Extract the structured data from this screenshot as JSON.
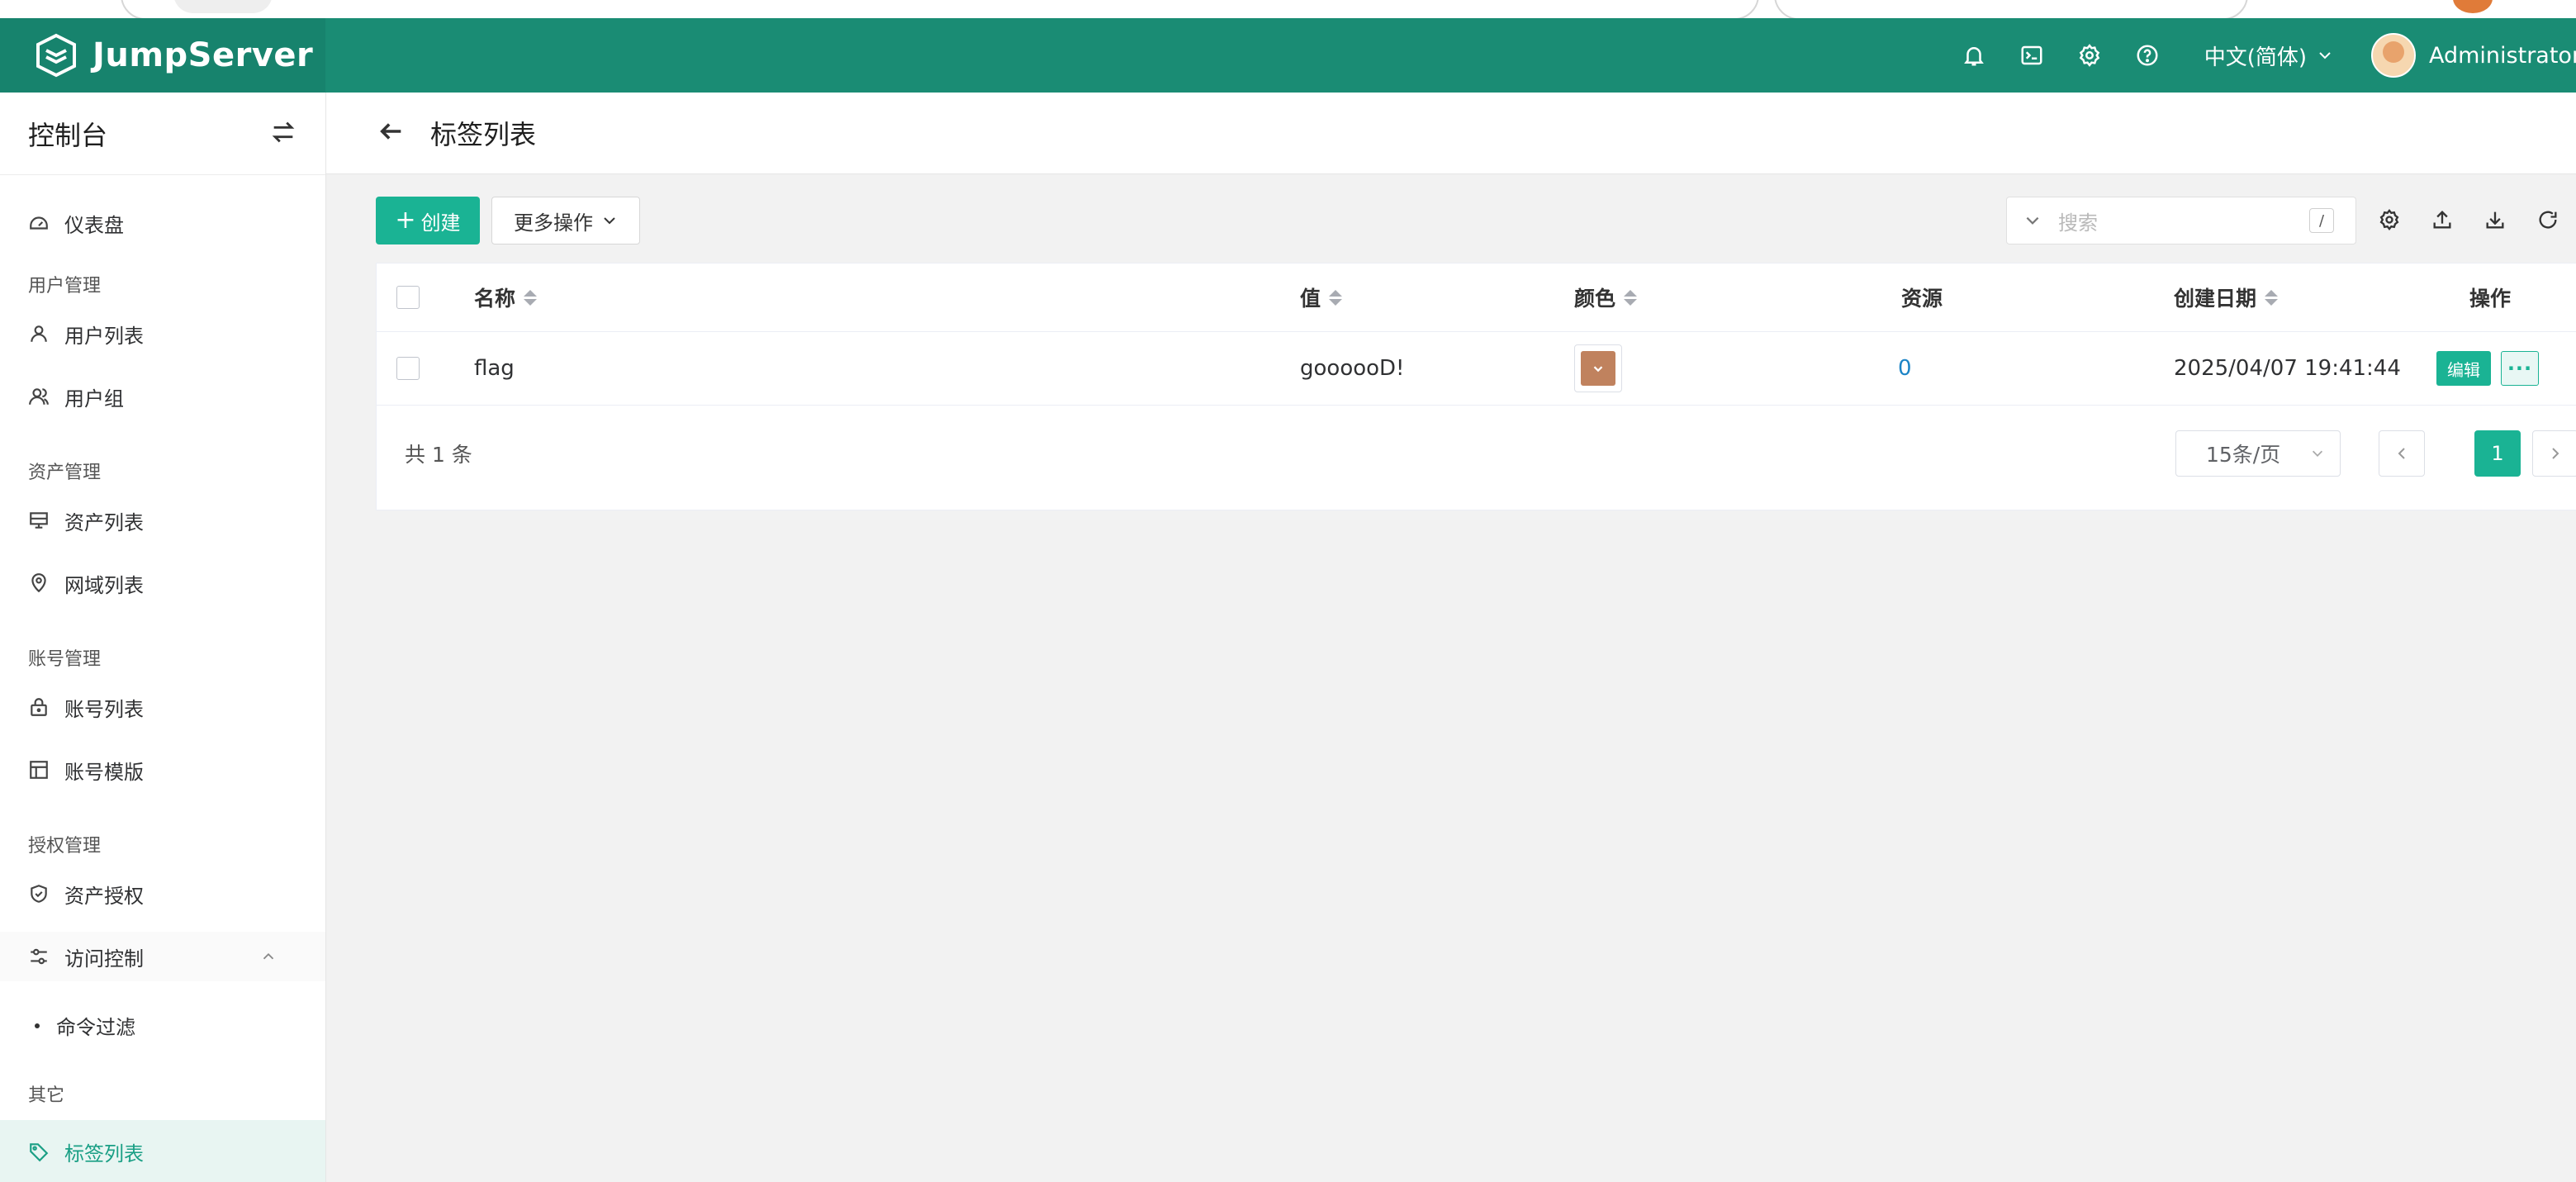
{
  "app": {
    "brand": "JumpServer",
    "language": "中文(简体)",
    "user": "Administrator"
  },
  "header_icons": [
    "bell-icon",
    "terminal-icon",
    "gear-icon",
    "help-icon"
  ],
  "sidebar": {
    "title": "控制台",
    "dashboard": "仪表盘",
    "groups": {
      "users": "用户管理",
      "assets": "资产管理",
      "accounts": "账号管理",
      "perms": "授权管理",
      "other": "其它"
    },
    "items": {
      "user_list": "用户列表",
      "user_group": "用户组",
      "asset_list": "资产列表",
      "zone_list": "网域列表",
      "account_list": "账号列表",
      "account_template": "账号模版",
      "asset_perm": "资产授权",
      "access_control": "访问控制",
      "cmd_filter": "命令过滤",
      "label_list": "标签列表"
    }
  },
  "page": {
    "title": "标签列表"
  },
  "toolbar": {
    "create_label": "创建",
    "more_label": "更多操作",
    "search_placeholder": "搜索",
    "search_shortcut": "/"
  },
  "table": {
    "columns": {
      "name": "名称",
      "value": "值",
      "color": "颜色",
      "resources": "资源",
      "created": "创建日期",
      "actions": "操作"
    },
    "rows": [
      {
        "name": "flag",
        "value": "goooooD!",
        "color": "#c0825e",
        "resources": "0",
        "created": "2025/04/07 19:41:44",
        "edit": "编辑",
        "more": "···"
      }
    ]
  },
  "pagination": {
    "total": "共 1 条",
    "page_size": "15条/页",
    "current_page": "1"
  },
  "colors": {
    "header": "#1a8c74",
    "accent": "#1ab394",
    "link": "#1c84c6"
  }
}
